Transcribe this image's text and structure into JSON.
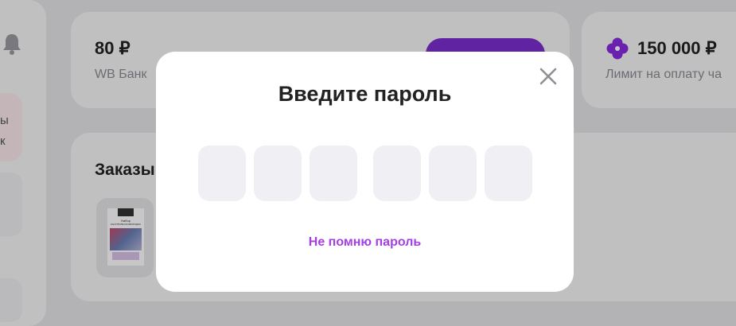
{
  "background": {
    "balance_card": {
      "amount": "80 ₽",
      "label": "WB Банк"
    },
    "limit_card": {
      "amount": "150 000 ₽",
      "label": "Лимит на оплату ча"
    },
    "orders_card": {
      "title": "Заказы"
    },
    "side_promo": {
      "line1": "ы",
      "line2": "к"
    },
    "thumbnail": {
      "line1": "Набор",
      "line2": "КАСТРЮЛЬ/СКОВОРОДОК"
    }
  },
  "modal": {
    "title": "Введите пароль",
    "pin_count": 6,
    "forgot_link": "Не помню пароль",
    "accent": "#a43ee6"
  },
  "icons": {
    "bell": "bell-icon",
    "close": "close-icon",
    "clover": "clover-icon"
  },
  "colors": {
    "brand_purple": "#7b2fd1",
    "pin_box": "#efeff4"
  }
}
